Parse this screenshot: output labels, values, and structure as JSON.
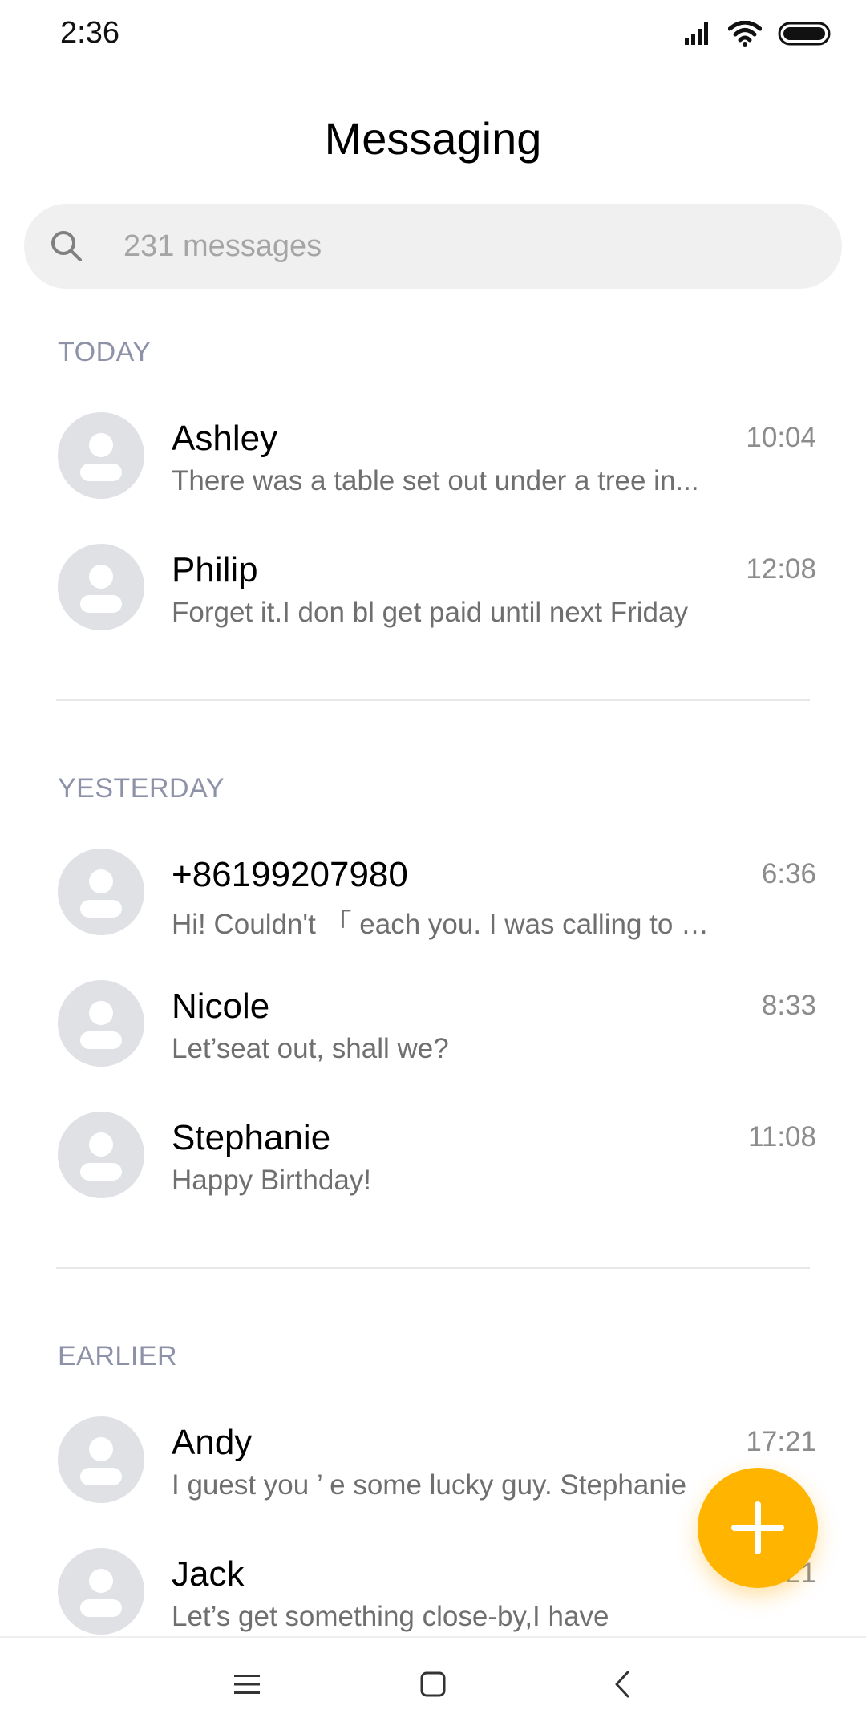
{
  "status_bar": {
    "time": "2:36",
    "icons": [
      "signal-icon",
      "wifi-icon",
      "battery-icon"
    ]
  },
  "header": {
    "title": "Messaging"
  },
  "search": {
    "placeholder": "231 messages",
    "icon": "search-icon"
  },
  "sections": [
    {
      "label": "TODAY",
      "conversations": [
        {
          "name": "Ashley",
          "preview": "There was a table set out under a tree in...",
          "time": "10:04"
        },
        {
          "name": "Philip",
          "preview": "Forget it.I don bl get paid until next Friday",
          "time": "12:08"
        }
      ]
    },
    {
      "label": "YESTERDAY",
      "conversations": [
        {
          "name": "+86199207980",
          "preview": "Hi! Couldn't 「 each you. I was calling to …",
          "time": "6:36"
        },
        {
          "name": "Nicole",
          "preview": "Let’seat out, shall we?",
          "time": "8:33"
        },
        {
          "name": "Stephanie",
          "preview": "Happy Birthday!",
          "time": "11:08"
        }
      ]
    },
    {
      "label": "EARLIER",
      "conversations": [
        {
          "name": "Andy",
          "preview": "I guest you ’ e some lucky guy. Stephanie",
          "time": "17:21"
        },
        {
          "name": "Jack",
          "preview": "Let’s get something close-by,I have",
          "time": "21"
        }
      ]
    }
  ],
  "fab": {
    "icon": "plus-icon"
  },
  "nav_bar": {
    "icons": [
      "menu-icon",
      "home-icon",
      "back-icon"
    ]
  },
  "colors": {
    "accent": "#ffb400",
    "section_header": "#8e92a8",
    "avatar_bg": "#dfe1e5",
    "search_bg": "#f0f0f0"
  }
}
